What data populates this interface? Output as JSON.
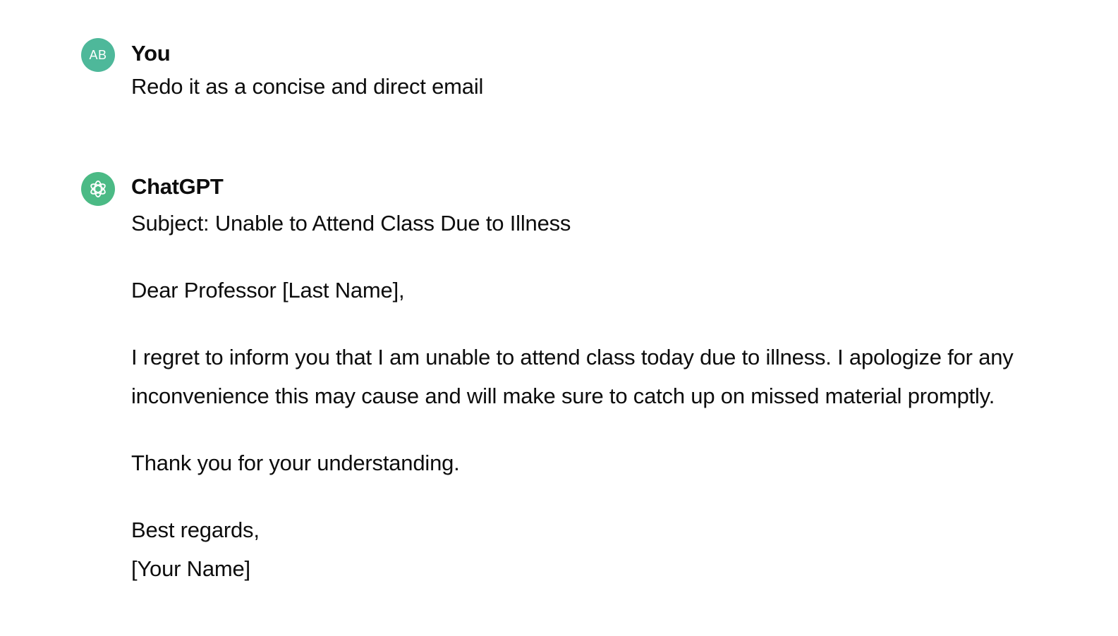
{
  "user_message": {
    "avatar_initials": "AB",
    "author": "You",
    "text": "Redo it as a concise and direct email"
  },
  "assistant_message": {
    "avatar_icon": "openai-logo-icon",
    "author": "ChatGPT",
    "subject": "Subject: Unable to Attend Class Due to Illness",
    "greeting": "Dear Professor [Last Name],",
    "body": "I regret to inform you that I am unable to attend class today due to illness. I apologize for any\ninconvenience this may cause and will make sure to catch up on missed material promptly.",
    "thanks": "Thank you for your understanding.",
    "closing": "Best regards,\n[Your Name]"
  },
  "colors": {
    "user_avatar": "#4eb89a",
    "assistant_avatar": "#4bba85",
    "text": "#0d0d0d",
    "background": "#ffffff"
  }
}
